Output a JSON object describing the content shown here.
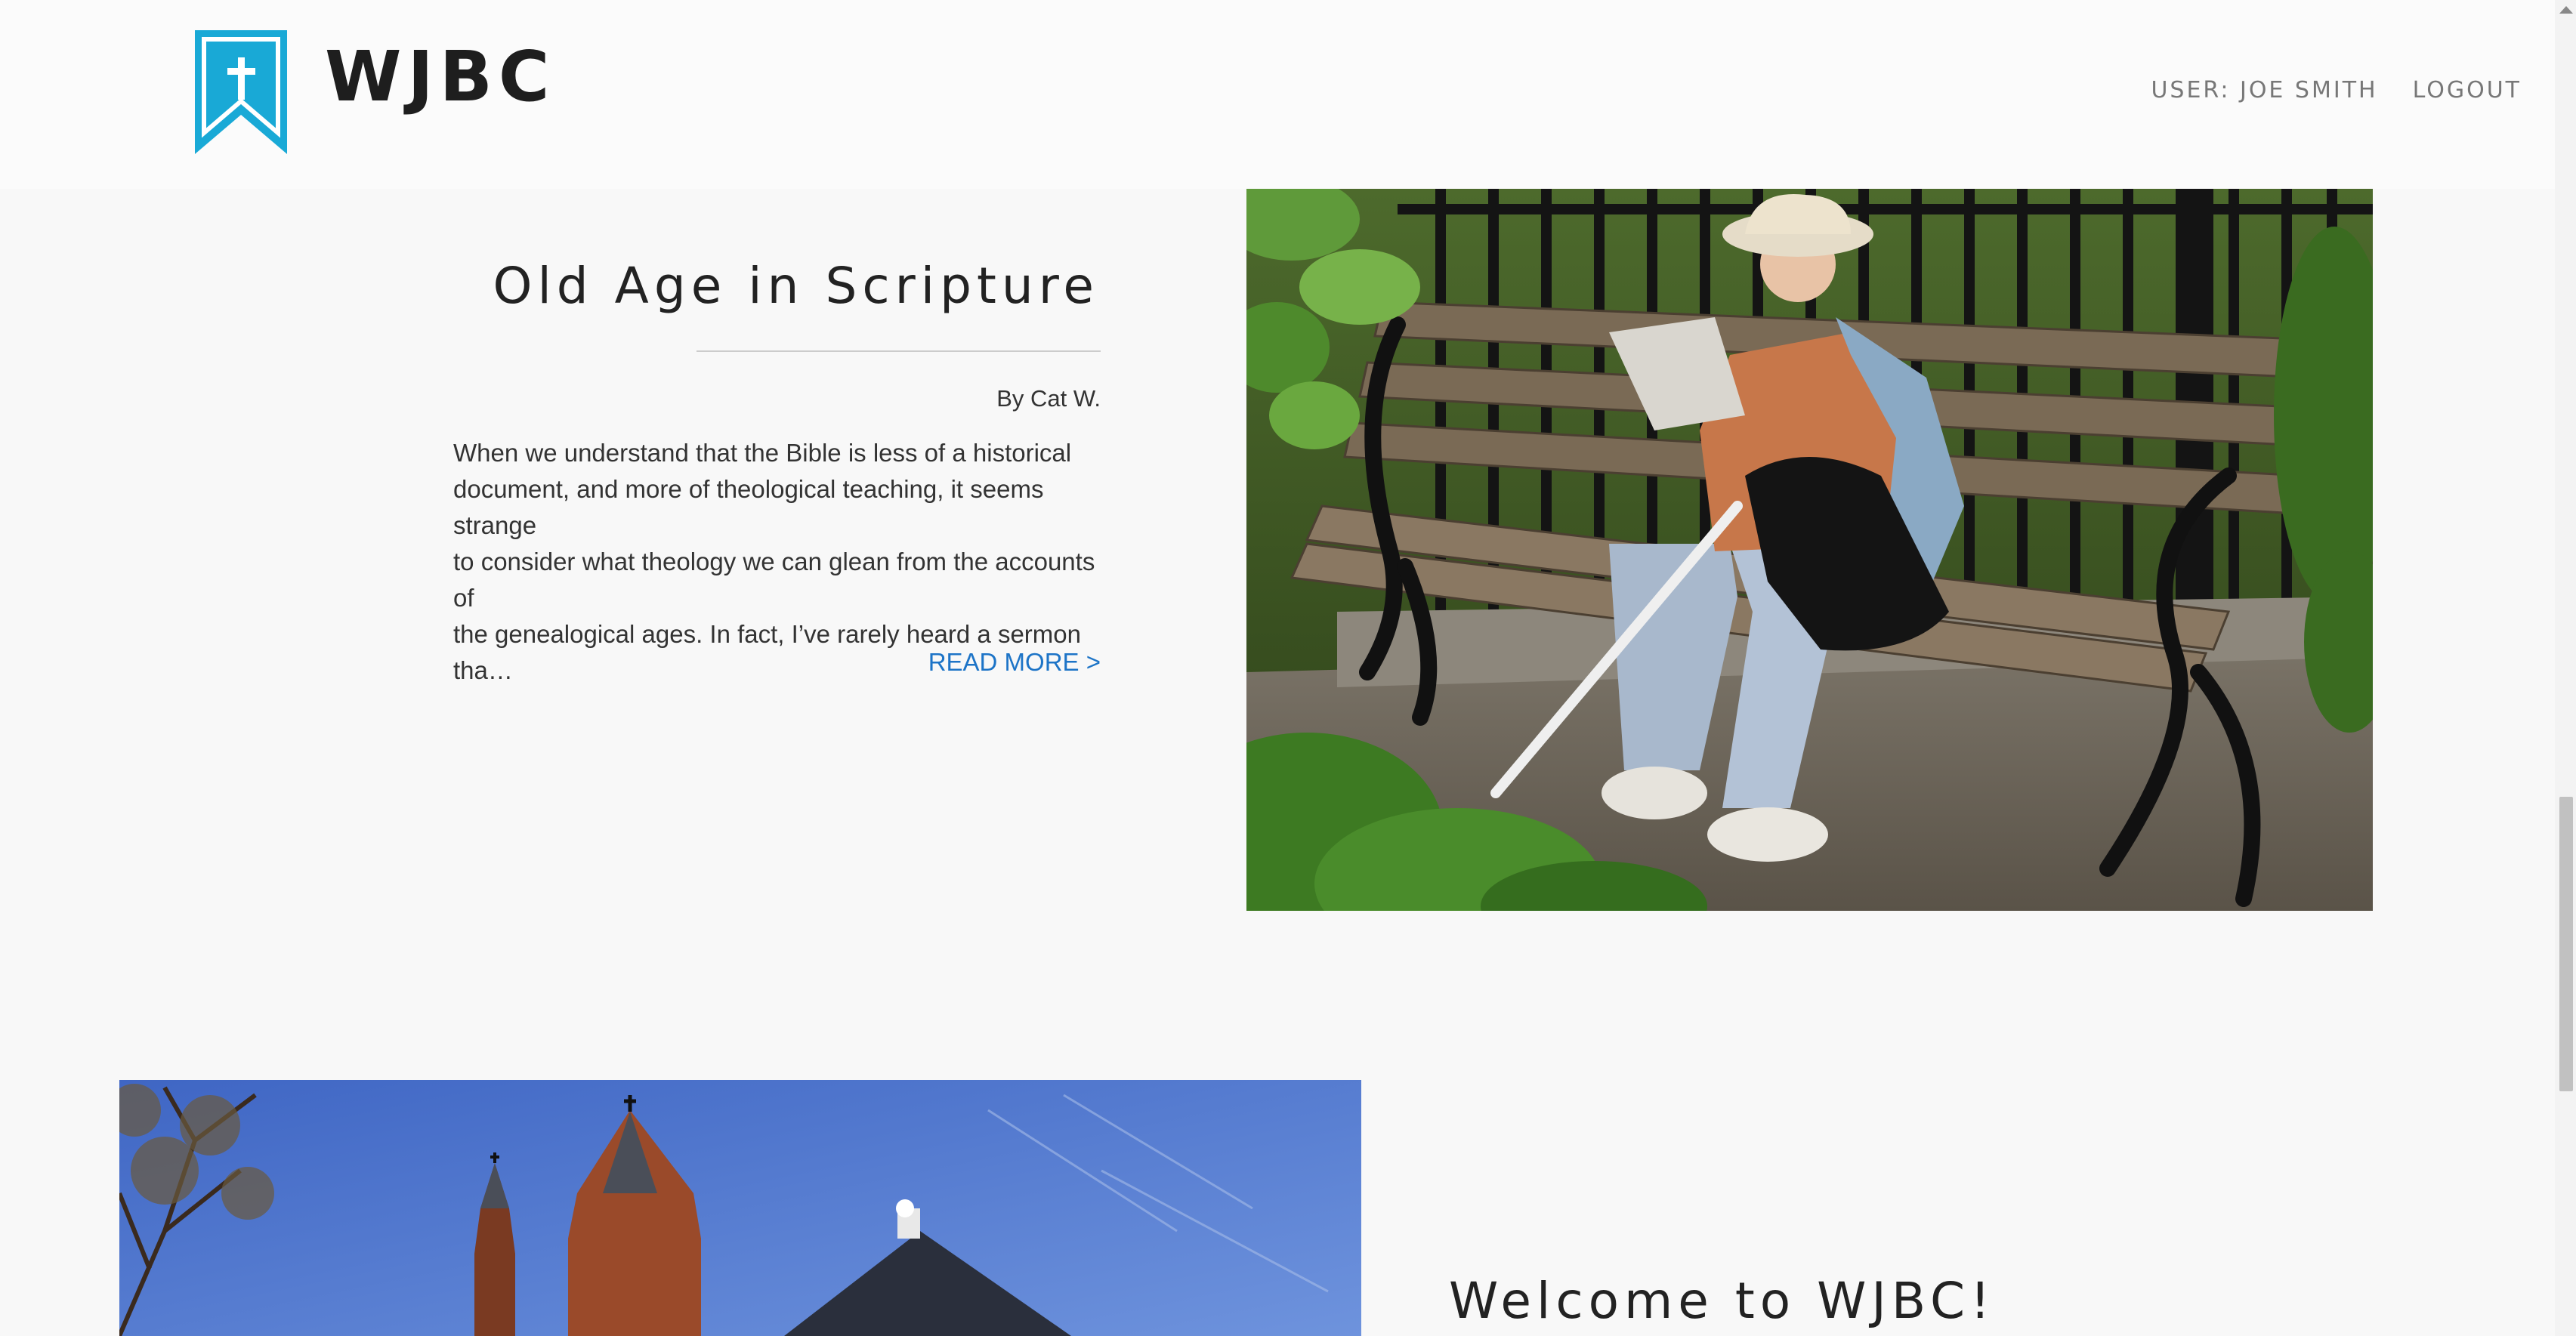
{
  "header": {
    "logo_text": "WJBC",
    "brand_color": "#19a9d6",
    "nav": {
      "user_label": "USER: JOE SMITH",
      "logout_label": "LOGOUT"
    }
  },
  "article": {
    "title": "Old Age in Scripture",
    "byline": "By Cat W.",
    "excerpt": "When we understand that the Bible is less of a historical\ndocument, and more of theological teaching, it seems strange\nto consider what theology we can glean from the accounts of\nthe genealogical ages. In fact, I’ve rarely heard a sermon tha…",
    "read_more": "READ MORE >",
    "link_color": "#1d74c7"
  },
  "welcome": {
    "title": "Welcome to WJBC!"
  }
}
